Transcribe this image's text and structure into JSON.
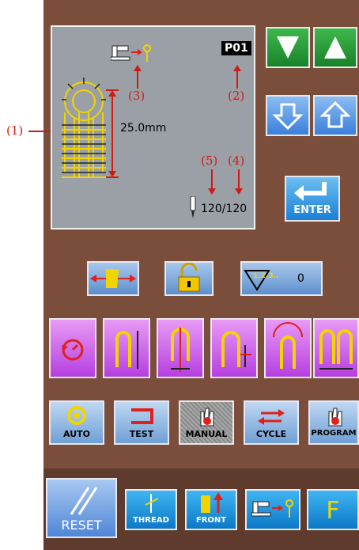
{
  "colors": {
    "panel": "#7a4e3b",
    "screen": "#9aa0a6",
    "purple": "#c84ce8",
    "blue": "#1a9be6",
    "annotation": "#d11a12",
    "pattern": "#f2d400"
  },
  "display": {
    "pattern_no": "P01",
    "size": "25.0mm",
    "count": "120/120",
    "threader_icon": "machine-to-eye-icon",
    "needle_icon": "needle-icon"
  },
  "annotations": {
    "a1": "(1)",
    "a2": "(2)",
    "a3": "(3)",
    "a4": "(4)",
    "a5": "(5)"
  },
  "right_buttons": {
    "down": "down-triangle-icon",
    "up": "up-triangle-icon",
    "prev": "arrow-down-icon",
    "next": "arrow-up-icon",
    "enter": "ENTER"
  },
  "mid_row": {
    "counter_label": "1.2.3..",
    "counter_value": "0",
    "move_icon": "move-icon",
    "lock_icon": "unlock-icon"
  },
  "mode_buttons": {
    "auto": "AUTO",
    "test": "TEST",
    "manual": "MANUAL",
    "cycle": "CYCLE",
    "program": "PROGRAM"
  },
  "bottom": {
    "reset": "RESET",
    "thread": "THREAD",
    "front": "FRONT",
    "f": "F"
  }
}
